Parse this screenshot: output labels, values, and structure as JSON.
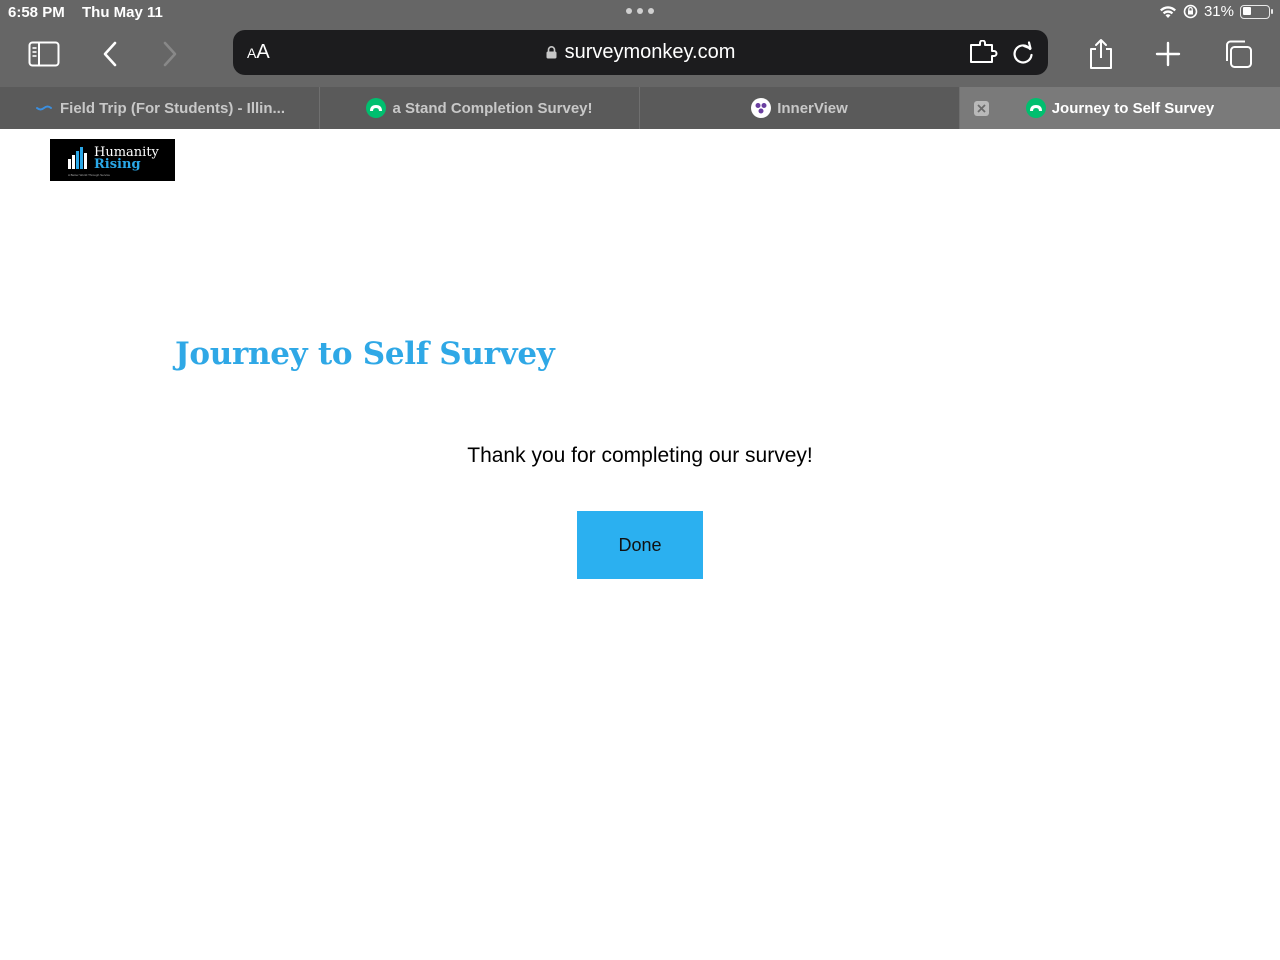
{
  "status_bar": {
    "time": "6:58 PM",
    "date": "Thu May 11",
    "battery_percent": "31%",
    "battery_level": 0.31,
    "icons": [
      "wifi-icon",
      "orientation-lock-icon",
      "battery-icon"
    ]
  },
  "toolbar": {
    "icons": [
      "sidebar-icon",
      "back-icon",
      "forward-icon",
      "share-icon",
      "new-tab-icon",
      "tabs-overview-icon"
    ],
    "address": {
      "aa_small": "A",
      "aa_large": "A",
      "url": "surveymonkey.com",
      "icons": [
        "lock-icon",
        "extension-icon",
        "reload-icon"
      ]
    }
  },
  "tabs": [
    {
      "label": "Field Trip (For Students) - Illin...",
      "favicon": "wave-favicon",
      "active": false
    },
    {
      "label": "a Stand Completion Survey!",
      "favicon": "surveymonkey-favicon",
      "active": false
    },
    {
      "label": "InnerView",
      "favicon": "innerview-favicon",
      "active": false
    },
    {
      "label": "Journey to Self Survey",
      "favicon": "surveymonkey-favicon",
      "active": true
    }
  ],
  "page": {
    "logo": {
      "line1": "Humanity",
      "line2": "Rising",
      "tagline": "A Better World Through Service"
    },
    "survey_title": "Journey to Self Survey",
    "thank_you_message": "Thank you for completing our survey!",
    "done_button": "Done"
  },
  "colors": {
    "chrome": "#666666",
    "tab_active": "#7a7a7a",
    "title_blue": "#2fa8e6",
    "button_blue": "#2bb0f0",
    "surveymonkey_green": "#00bf6f"
  }
}
